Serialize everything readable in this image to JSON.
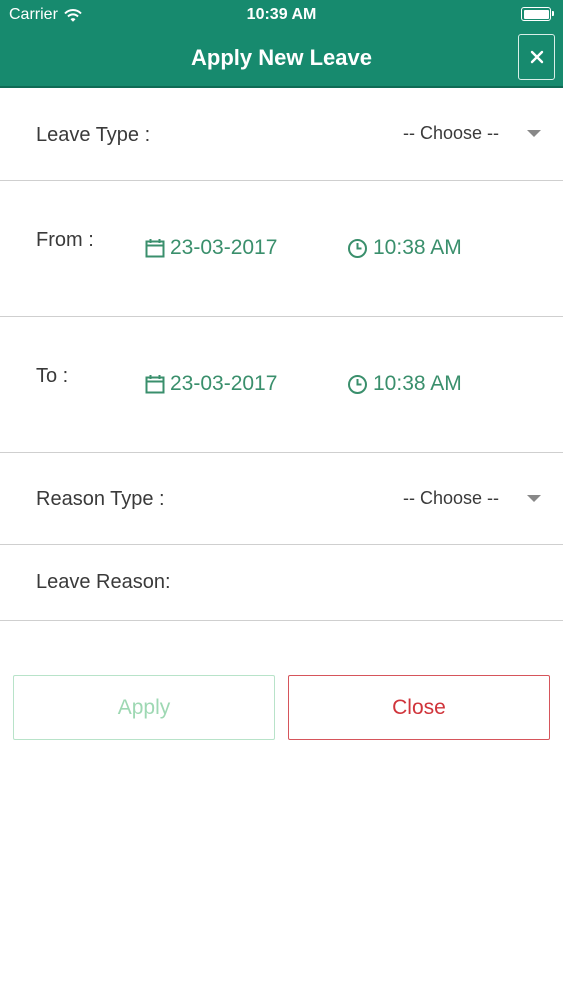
{
  "status_bar": {
    "carrier": "Carrier",
    "time": "10:39 AM"
  },
  "header": {
    "title": "Apply New Leave",
    "close_icon": "close-icon"
  },
  "form": {
    "leave_type": {
      "label": "Leave Type :",
      "value": "-- Choose --"
    },
    "from": {
      "label": "From :",
      "date": "23-03-2017",
      "time": "10:38 AM"
    },
    "to": {
      "label": "To :",
      "date": "23-03-2017",
      "time": "10:38 AM"
    },
    "reason_type": {
      "label": "Reason Type :",
      "value": "-- Choose --"
    },
    "leave_reason": {
      "label": "Leave Reason:"
    }
  },
  "buttons": {
    "apply": "Apply",
    "close": "Close"
  },
  "colors": {
    "header": "#178a6e",
    "accent": "#3a8f6c",
    "danger": "#d0343b",
    "apply_disabled": "#9ed8b3"
  },
  "icons": [
    "wifi-icon",
    "battery-icon",
    "close-icon",
    "calendar-icon",
    "clock-icon",
    "chevron-down-icon"
  ]
}
